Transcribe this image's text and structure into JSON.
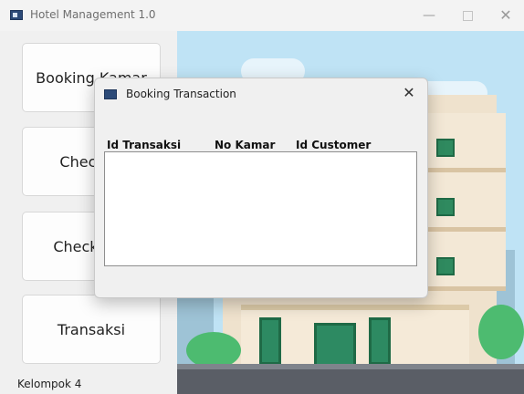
{
  "window": {
    "title": "Hotel Management 1.0",
    "controls": {
      "minimize": "—",
      "close": "✕"
    }
  },
  "sidebar": {
    "items": [
      {
        "label": "Booking Kamar"
      },
      {
        "label": "Check In"
      },
      {
        "label": "Check Out"
      },
      {
        "label": "Transaksi"
      }
    ],
    "footer": "Kelompok 4"
  },
  "dialog": {
    "title": "Booking Transaction",
    "close": "✕",
    "columns": [
      "Id Transaksi",
      "No Kamar",
      "Id Customer"
    ],
    "rows": []
  },
  "icons": {
    "app": "app-window-icon",
    "dialog": "dialog-window-icon"
  },
  "colors": {
    "sky": "#bfe3f5",
    "accent_green": "#2f8a5f"
  }
}
